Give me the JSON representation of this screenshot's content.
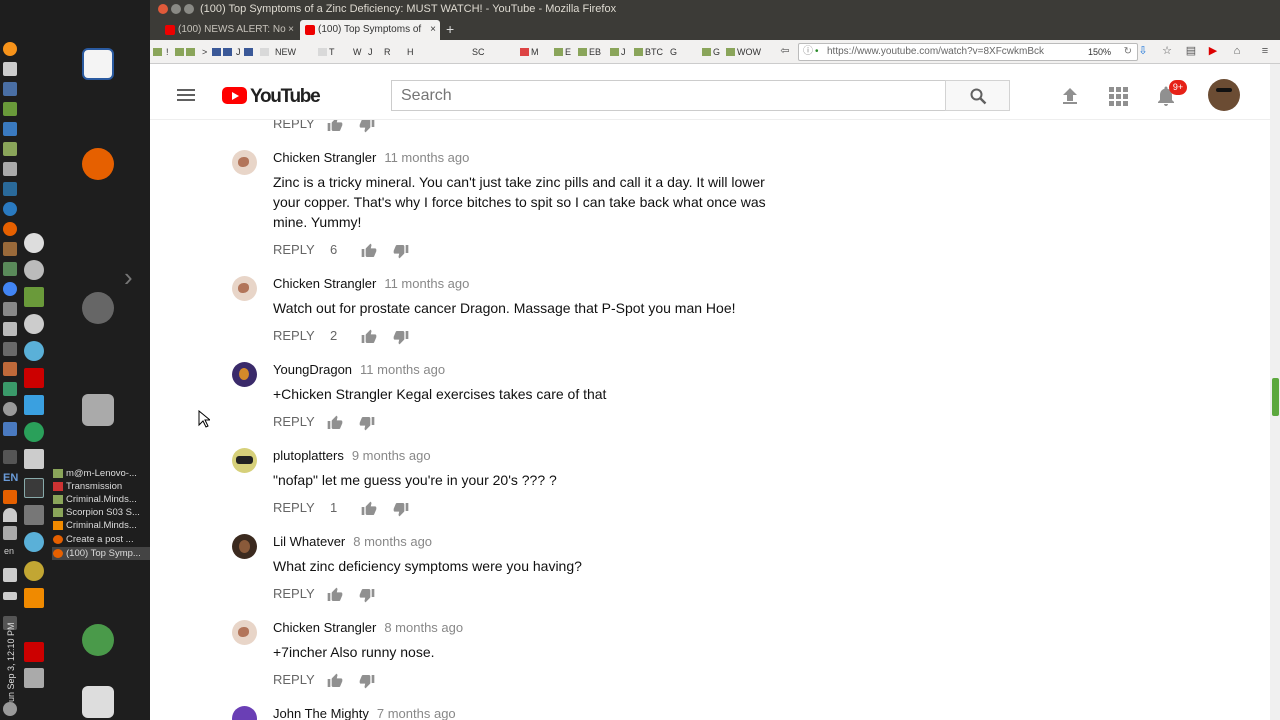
{
  "window": {
    "title": "(100) Top Symptoms of a Zinc Deficiency: MUST WATCH! - YouTube - Mozilla Firefox"
  },
  "tabs": [
    {
      "label": "(100) NEWS ALERT: No"
    },
    {
      "label": "(100) Top Symptoms of"
    }
  ],
  "bookmarks": [
    "!",
    ">",
    "J",
    "NEW",
    "T",
    "W",
    "J",
    "R",
    "H",
    "SC",
    "M",
    "E",
    "EB",
    "J",
    "BTC",
    "G",
    "G",
    "WOW"
  ],
  "navbar": {
    "url": "https://www.youtube.com/watch?v=8XFcwkmBck",
    "zoom": "150%"
  },
  "taskbar": {
    "tray_items": [
      "m@m-Lenovo-...",
      "Transmission",
      "Criminal.Minds...",
      "Scorpion S03 S...",
      "Criminal.Minds...",
      "Create a post ...",
      "(100) Top Symp..."
    ],
    "lang": "EN",
    "lang_small": "en",
    "clock": "Sun Sep 3, 12:10 PM"
  },
  "youtube": {
    "logo_text": "YouTube",
    "search_placeholder": "Search",
    "notification_count": "9+",
    "colors": {
      "brand": "#ff0000",
      "badge": "#e62117",
      "scroll_thumb": "#5ca83e"
    }
  },
  "comments": {
    "reply_label": "REPLY",
    "items": [
      {
        "author": "",
        "time": "",
        "text": "",
        "likes": "",
        "avatar": "chicken"
      },
      {
        "author": "Chicken Strangler",
        "time": "11 months ago",
        "text": "Zinc is a tricky mineral. You can't just take zinc pills and call it a day. It will lower your copper. That's why I force bitches to spit so I can take back what once was mine. Yummy!",
        "likes": "6",
        "avatar": "chicken"
      },
      {
        "author": "Chicken Strangler",
        "time": "11 months ago",
        "text": "Watch out for prostate cancer Dragon. Massage that P-Spot you man Hoe!",
        "likes": "2",
        "avatar": "chicken"
      },
      {
        "author": "YoungDragon",
        "time": "11 months ago",
        "text": "+Chicken Strangler Kegal exercises takes care of that",
        "likes": "",
        "avatar": "dragon"
      },
      {
        "author": "plutoplatters",
        "time": "9 months ago",
        "text": "\"nofap\" let me guess you're in your 20's ??? ?",
        "likes": "1",
        "avatar": "pluto"
      },
      {
        "author": "Lil Whatever",
        "time": "8 months ago",
        "text": "What zinc deficiency symptoms were you having?",
        "likes": "",
        "avatar": "lil"
      },
      {
        "author": "Chicken Strangler",
        "time": "8 months ago",
        "text": "+7incher Also runny nose.",
        "likes": "",
        "avatar": "chicken"
      },
      {
        "author": "John The Mighty",
        "time": "7 months ago",
        "text": "",
        "likes": "",
        "avatar": "john"
      }
    ]
  }
}
